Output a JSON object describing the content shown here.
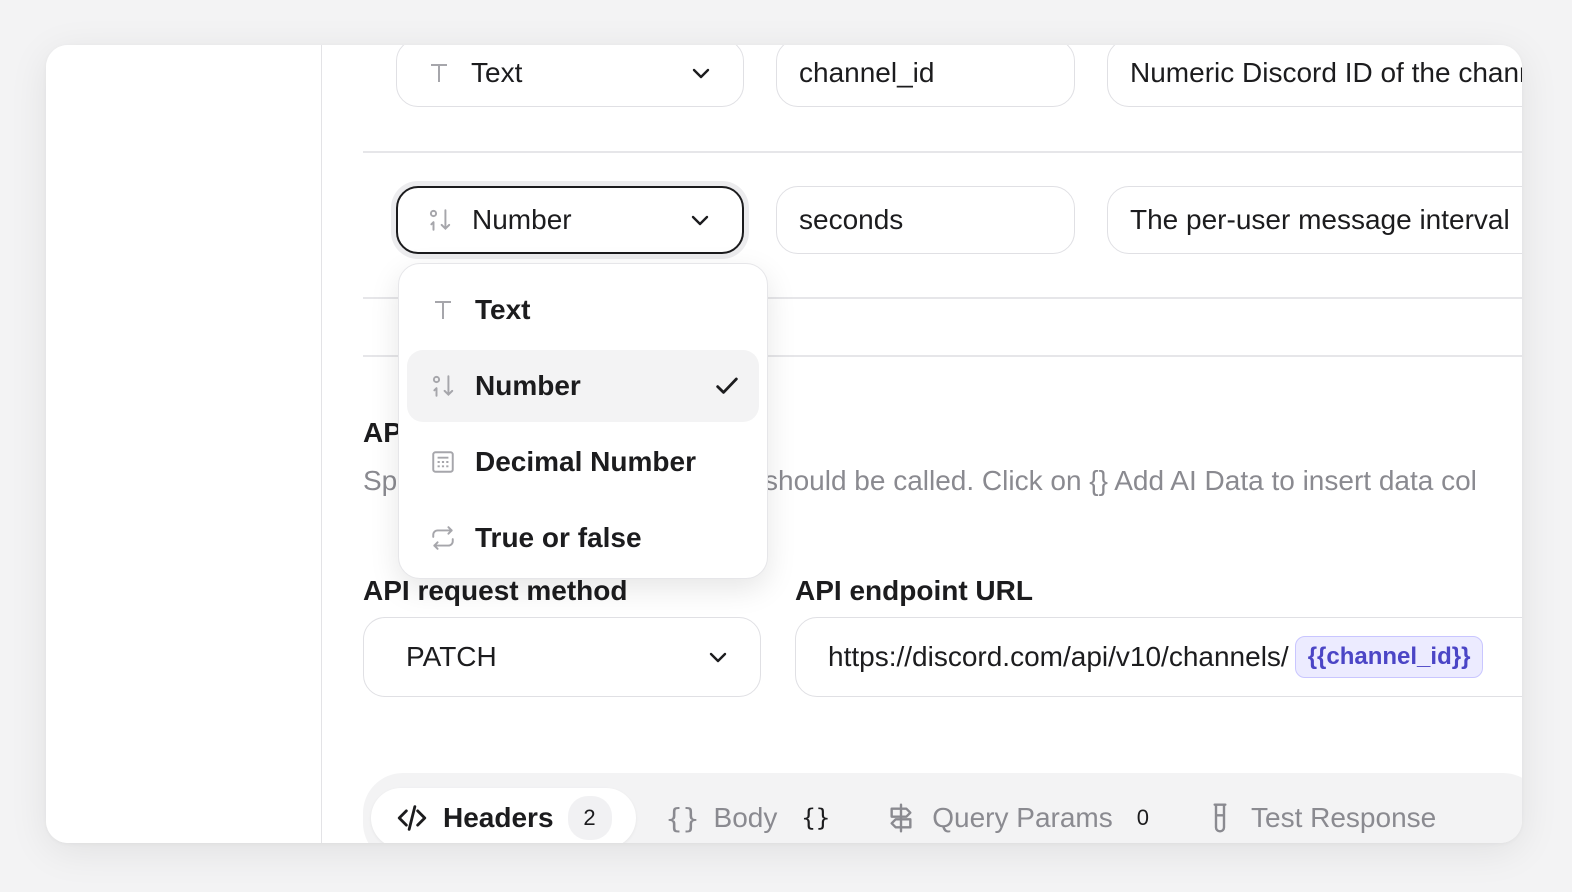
{
  "params": [
    {
      "type_label": "Text",
      "type_icon": "text-type-icon",
      "name": "channel_id",
      "description": "Numeric Discord ID of the channel"
    },
    {
      "type_label": "Number",
      "type_icon": "number-type-icon",
      "name": "seconds",
      "description": "The per-user message interval"
    }
  ],
  "type_dropdown": {
    "options": [
      {
        "label": "Text",
        "icon": "text-type-icon"
      },
      {
        "label": "Number",
        "icon": "number-type-icon",
        "selected": true
      },
      {
        "label": "Decimal Number",
        "icon": "decimal-calculator-icon"
      },
      {
        "label": "True or false",
        "icon": "toggle-repeat-icon"
      }
    ]
  },
  "api_section": {
    "title_visible": "AP",
    "desc_left": "Sp",
    "desc_right": "should be called. Click on {} Add AI Data to insert data col"
  },
  "request": {
    "method_label": "API request method",
    "method_value": "PATCH",
    "url_label": "API endpoint URL",
    "url_value": "https://discord.com/api/v10/channels/",
    "url_variable": "{{channel_id}}"
  },
  "tabs": [
    {
      "label": "Headers",
      "count": "2",
      "icon": "code-icon",
      "active": true
    },
    {
      "label": "Body",
      "count": "{}",
      "icon": "braces-icon"
    },
    {
      "label": "Query Params",
      "count": "0",
      "icon": "signpost-icon"
    },
    {
      "label": "Test Response",
      "count": "",
      "icon": "test-tube-icon"
    }
  ],
  "colors": {
    "accent_pill_bg": "#ecebff",
    "accent_pill_text": "#4b45c6",
    "muted": "#8a8a90"
  }
}
